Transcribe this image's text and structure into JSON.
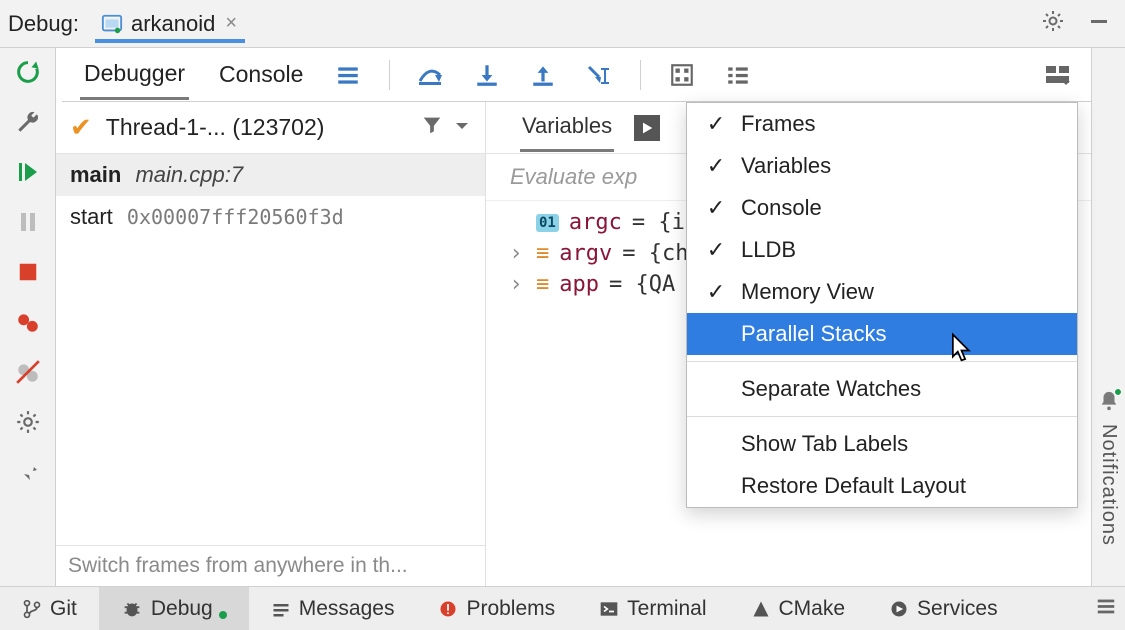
{
  "header": {
    "debug_label": "Debug:",
    "run_config": "arkanoid"
  },
  "tabs": {
    "debugger": "Debugger",
    "console": "Console"
  },
  "thread": "Thread-1-... (123702)",
  "frames": [
    {
      "fn": "main",
      "loc": "main.cpp:7",
      "addr": ""
    },
    {
      "fn": "start",
      "loc": "",
      "addr": "0x00007fff20560f3d"
    }
  ],
  "frames_footer": "Switch frames from anywhere in th...",
  "vars_tab": "Variables",
  "eval_placeholder": "Evaluate exp",
  "vars": [
    {
      "badge": "01",
      "name": "argc",
      "val": "= {in"
    },
    {
      "badge": "≡",
      "name": "argv",
      "val": "= {ch"
    },
    {
      "badge": "≡",
      "name": "app",
      "val": "= {QA"
    }
  ],
  "menu": {
    "items": [
      {
        "label": "Frames",
        "checked": true
      },
      {
        "label": "Variables",
        "checked": true
      },
      {
        "label": "Console",
        "checked": true
      },
      {
        "label": "LLDB",
        "checked": true
      },
      {
        "label": "Memory View",
        "checked": true
      },
      {
        "label": "Parallel Stacks",
        "checked": false,
        "highlight": true
      }
    ],
    "group2": [
      "Separate Watches"
    ],
    "group3": [
      "Show Tab Labels",
      "Restore Default Layout"
    ]
  },
  "right_strip": "Notifications",
  "status": {
    "git": "Git",
    "debug": "Debug",
    "messages": "Messages",
    "problems": "Problems",
    "terminal": "Terminal",
    "cmake": "CMake",
    "services": "Services"
  }
}
